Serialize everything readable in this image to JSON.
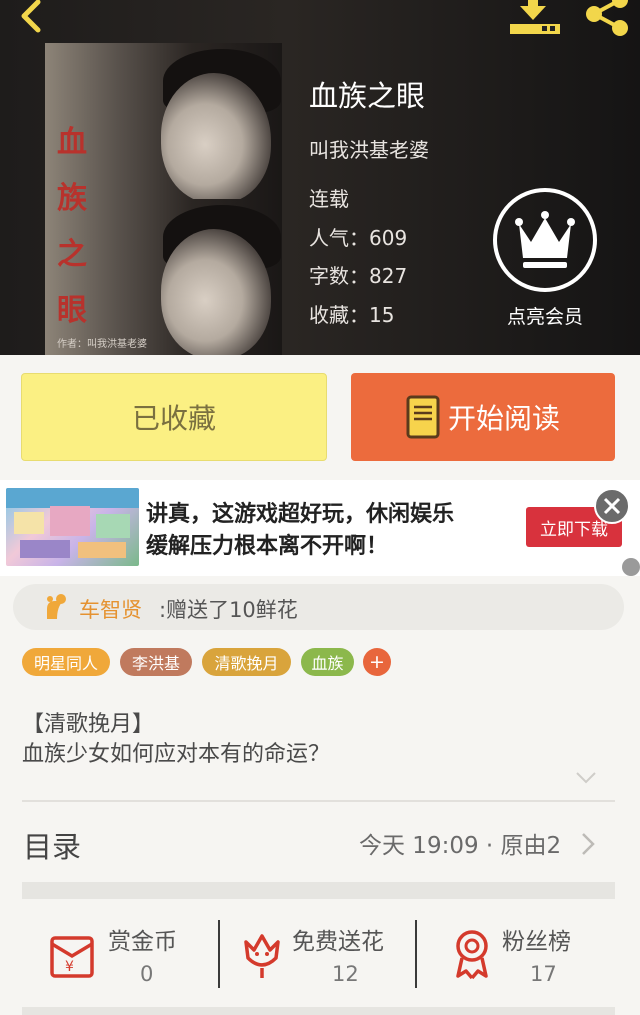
{
  "book": {
    "title": "血族之眼",
    "author": "叫我洪基老婆",
    "status": "连载",
    "popularity": "人气：609",
    "word_count": "字数：827",
    "favorites": "收藏：15",
    "cover_title": "血族之眼",
    "cover_author": "作者：叫我洪基老婆"
  },
  "vip": {
    "label": "点亮会员",
    "icon": "crown-icon"
  },
  "header": {
    "back_icon": "back-chevron-icon",
    "download_icon": "download-icon",
    "share_icon": "share-icon",
    "icon_color": "#f2d64b"
  },
  "actions": {
    "favorite_label": "已收藏",
    "read_label": "开始阅读",
    "favorite_color": "#fbf083",
    "read_color": "#ec6b3d"
  },
  "ad": {
    "line1": "讲真，这游戏超好玩，休闲娱乐",
    "line2": "缓解压力根本离不开啊！",
    "cta": "立即下载"
  },
  "gift": {
    "user": "车智贤",
    "message": ":赠送了10鲜花"
  },
  "tags": [
    {
      "label": "明星同人",
      "color": "#f0a83a"
    },
    {
      "label": "李洪基",
      "color": "#c07a5e"
    },
    {
      "label": "清歌挽月",
      "color": "#d9a43c"
    },
    {
      "label": "血族",
      "color": "#8cb84c"
    }
  ],
  "tag_add": "+",
  "description": {
    "line1": "【清歌挽月】",
    "line2": "血族少女如何应对本有的命运？"
  },
  "toc": {
    "label": "目录",
    "meta": "今天 19:09 · 原由2"
  },
  "stats": [
    {
      "label": "赏金币",
      "value": "0",
      "icon": "red-envelope-icon"
    },
    {
      "label": "免费送花",
      "value": "12",
      "icon": "flower-icon"
    },
    {
      "label": "粉丝榜",
      "value": "17",
      "icon": "medal-icon"
    }
  ],
  "accent_red": "#d43a2c"
}
